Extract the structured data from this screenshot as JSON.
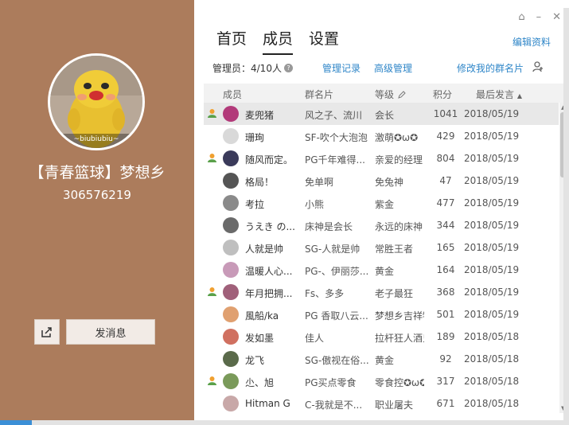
{
  "profile": {
    "avatar_caption": "~biubiubiu~",
    "group_name": "【青春篮球】梦想乡",
    "group_id": "306576219",
    "send_message_label": "发消息"
  },
  "window_controls": [
    "⌂",
    "–",
    "✕"
  ],
  "tabs": [
    {
      "label": "首页",
      "active": false
    },
    {
      "label": "成员",
      "active": true
    },
    {
      "label": "设置",
      "active": false
    }
  ],
  "edit_profile_label": "编辑资料",
  "sub_bar": {
    "admin_count": "管理员：4/10人",
    "manage_log": "管理记录",
    "advanced": "高级管理",
    "edit_card": "修改我的群名片"
  },
  "columns": {
    "member": "成员",
    "card": "群名片",
    "rank": "等级",
    "score": "积分",
    "last_post": "最后发言"
  },
  "colors": {
    "panel_brown": "#ac7c5c",
    "link_blue": "#2f86c8",
    "admin_orange": "#f0a030"
  },
  "members": [
    {
      "admin": true,
      "nick": "麦兜猪",
      "card": "风之子、流川",
      "rank": "会长",
      "score": "1041",
      "date": "2018/05/19",
      "avatar_color": "#b23a7a",
      "selected": true
    },
    {
      "admin": false,
      "nick": "珊珣",
      "card": "SF-吹个大泡泡",
      "rank": "激萌✪ω✪",
      "score": "429",
      "date": "2018/05/19",
      "avatar_color": "#d9d9d9",
      "selected": false
    },
    {
      "admin": true,
      "nick": "随风而定。",
      "card": "PG千年难得...",
      "rank": "亲爱的经理",
      "score": "804",
      "date": "2018/05/19",
      "avatar_color": "#3a3a5a",
      "selected": false
    },
    {
      "admin": false,
      "nick": "格局！",
      "card": "免单啊",
      "rank": "免兔神",
      "score": "47",
      "date": "2018/05/19",
      "avatar_color": "#555555",
      "selected": false
    },
    {
      "admin": false,
      "nick": "考拉",
      "card": "小熊",
      "rank": "紫金",
      "score": "477",
      "date": "2018/05/19",
      "avatar_color": "#8a8a8a",
      "selected": false
    },
    {
      "admin": false,
      "nick": "うえき の...",
      "card": "床神是会长",
      "rank": "永远的床神",
      "score": "344",
      "date": "2018/05/19",
      "avatar_color": "#6a6a6a",
      "selected": false
    },
    {
      "admin": false,
      "nick": "人就是帅",
      "card": "SG-人就是帅",
      "rank": "常胜王者",
      "score": "165",
      "date": "2018/05/19",
      "avatar_color": "#bfbfbf",
      "selected": false
    },
    {
      "admin": false,
      "nick": "温暖人心...",
      "card": "PG-、伊丽莎...",
      "rank": "黄金",
      "score": "164",
      "date": "2018/05/19",
      "avatar_color": "#c89ab8",
      "selected": false
    },
    {
      "admin": true,
      "nick": "年月把拥...",
      "card": "Fs、多多",
      "rank": "老子最狂",
      "score": "368",
      "date": "2018/05/19",
      "avatar_color": "#a0607a",
      "selected": false
    },
    {
      "admin": false,
      "nick": "風船/ka",
      "card": "PG 香取八云...",
      "rank": "梦想乡吉祥物",
      "score": "501",
      "date": "2018/05/19",
      "avatar_color": "#e0a070",
      "selected": false
    },
    {
      "admin": false,
      "nick": "发如墨",
      "card": "佳人",
      "rank": "拉杆狂人酒鬼",
      "score": "189",
      "date": "2018/05/18",
      "avatar_color": "#d07060",
      "selected": false
    },
    {
      "admin": false,
      "nick": "龙飞",
      "card": "SG-傲视在俗...",
      "rank": "黄金",
      "score": "92",
      "date": "2018/05/18",
      "avatar_color": "#5a6a4a",
      "selected": false
    },
    {
      "admin": true,
      "nick": "尐、旭",
      "card": "PG买点零食",
      "rank": "零食控✪ω✪",
      "score": "317",
      "date": "2018/05/18",
      "avatar_color": "#7a9a5a",
      "selected": false
    },
    {
      "admin": false,
      "nick": "Hitman G",
      "card": "C-我就是不...",
      "rank": "职业屠夫",
      "score": "671",
      "date": "2018/05/18",
      "avatar_color": "#c8a8a8",
      "selected": false
    }
  ]
}
